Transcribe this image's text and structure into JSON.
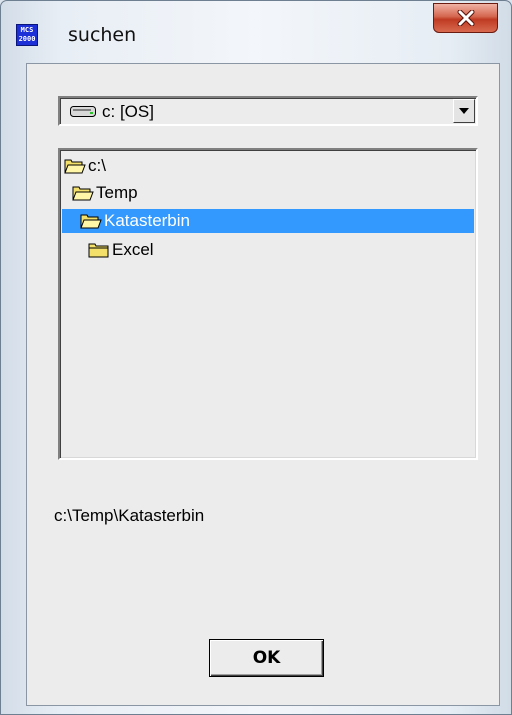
{
  "window": {
    "title": "suchen",
    "app_icon_text": [
      "MCS",
      "2000"
    ],
    "close_label": "X"
  },
  "drive_select": {
    "value": "c: [OS]"
  },
  "folders": [
    {
      "label": "c:\\",
      "state": "open"
    },
    {
      "label": "Temp",
      "state": "open"
    },
    {
      "label": "Katasterbin",
      "state": "open",
      "selected": true
    },
    {
      "label": "Excel",
      "state": "closed"
    }
  ],
  "current_path": "c:\\Temp\\Katasterbin",
  "ok_button": {
    "label": "OK"
  },
  "colors": {
    "selection": "#3399ff",
    "dialog_bg": "#ececec",
    "close_button": "#c8432c"
  }
}
